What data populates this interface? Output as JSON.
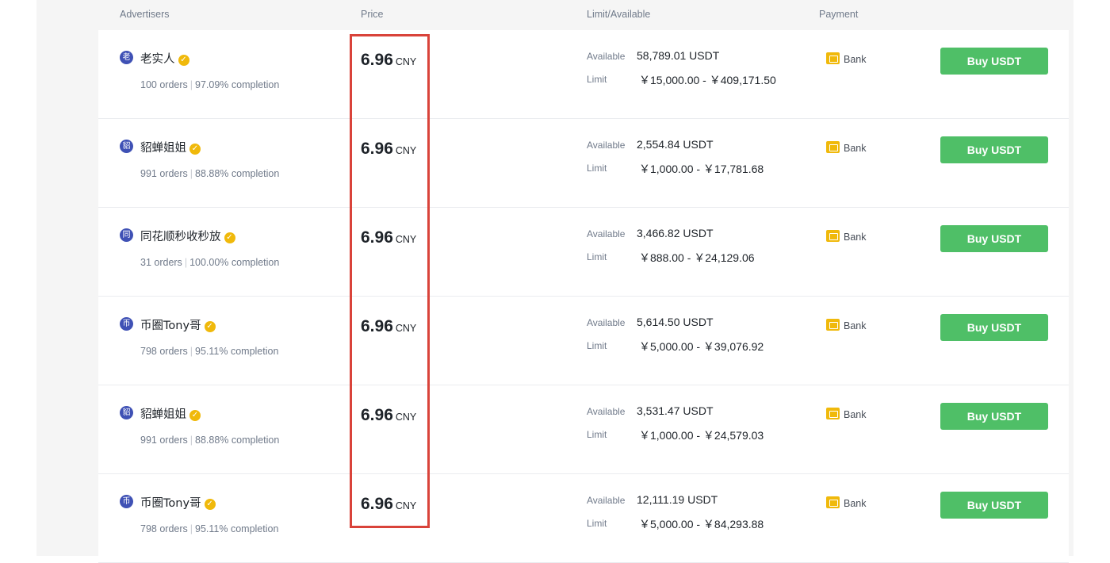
{
  "header": {
    "advertisers": "Advertisers",
    "price": "Price",
    "limit_available": "Limit/Available",
    "payment": "Payment"
  },
  "rows": [
    {
      "avatar_char": "老",
      "name": "老实人",
      "orders": "100 orders",
      "completion": "97.09% completion",
      "price": "6.96",
      "currency": "CNY",
      "available_label": "Available",
      "available": "58,789.01 USDT",
      "limit_label": "Limit",
      "limit": "￥15,000.00 - ￥409,171.50",
      "payment": "Bank",
      "button": "Buy USDT"
    },
    {
      "avatar_char": "貂",
      "name": "貂蝉姐姐",
      "orders": "991 orders",
      "completion": "88.88% completion",
      "price": "6.96",
      "currency": "CNY",
      "available_label": "Available",
      "available": "2,554.84 USDT",
      "limit_label": "Limit",
      "limit": "￥1,000.00 - ￥17,781.68",
      "payment": "Bank",
      "button": "Buy USDT"
    },
    {
      "avatar_char": "同",
      "name": "同花顺秒收秒放",
      "orders": "31 orders",
      "completion": "100.00% completion",
      "price": "6.96",
      "currency": "CNY",
      "available_label": "Available",
      "available": "3,466.82 USDT",
      "limit_label": "Limit",
      "limit": "￥888.00 - ￥24,129.06",
      "payment": "Bank",
      "button": "Buy USDT"
    },
    {
      "avatar_char": "币",
      "name": "币圈Tony哥",
      "orders": "798 orders",
      "completion": "95.11% completion",
      "price": "6.96",
      "currency": "CNY",
      "available_label": "Available",
      "available": "5,614.50 USDT",
      "limit_label": "Limit",
      "limit": "￥5,000.00 - ￥39,076.92",
      "payment": "Bank",
      "button": "Buy USDT"
    },
    {
      "avatar_char": "貂",
      "name": "貂蝉姐姐",
      "orders": "991 orders",
      "completion": "88.88% completion",
      "price": "6.96",
      "currency": "CNY",
      "available_label": "Available",
      "available": "3,531.47 USDT",
      "limit_label": "Limit",
      "limit": "￥1,000.00 - ￥24,579.03",
      "payment": "Bank",
      "button": "Buy USDT"
    },
    {
      "avatar_char": "币",
      "name": "币圈Tony哥",
      "orders": "798 orders",
      "completion": "95.11% completion",
      "price": "6.96",
      "currency": "CNY",
      "available_label": "Available",
      "available": "12,111.19 USDT",
      "limit_label": "Limit",
      "limit": "￥5,000.00 - ￥84,293.88",
      "payment": "Bank",
      "button": "Buy USDT"
    }
  ],
  "icons": {
    "verified": "check-badge-icon",
    "payment": "bank-card-icon"
  },
  "colors": {
    "buy_button": "#4fbf67",
    "verified_badge": "#f0b90b",
    "bank_icon": "#f0b90b",
    "highlight_box": "#d9433a",
    "avatar": "#3f51b5"
  }
}
